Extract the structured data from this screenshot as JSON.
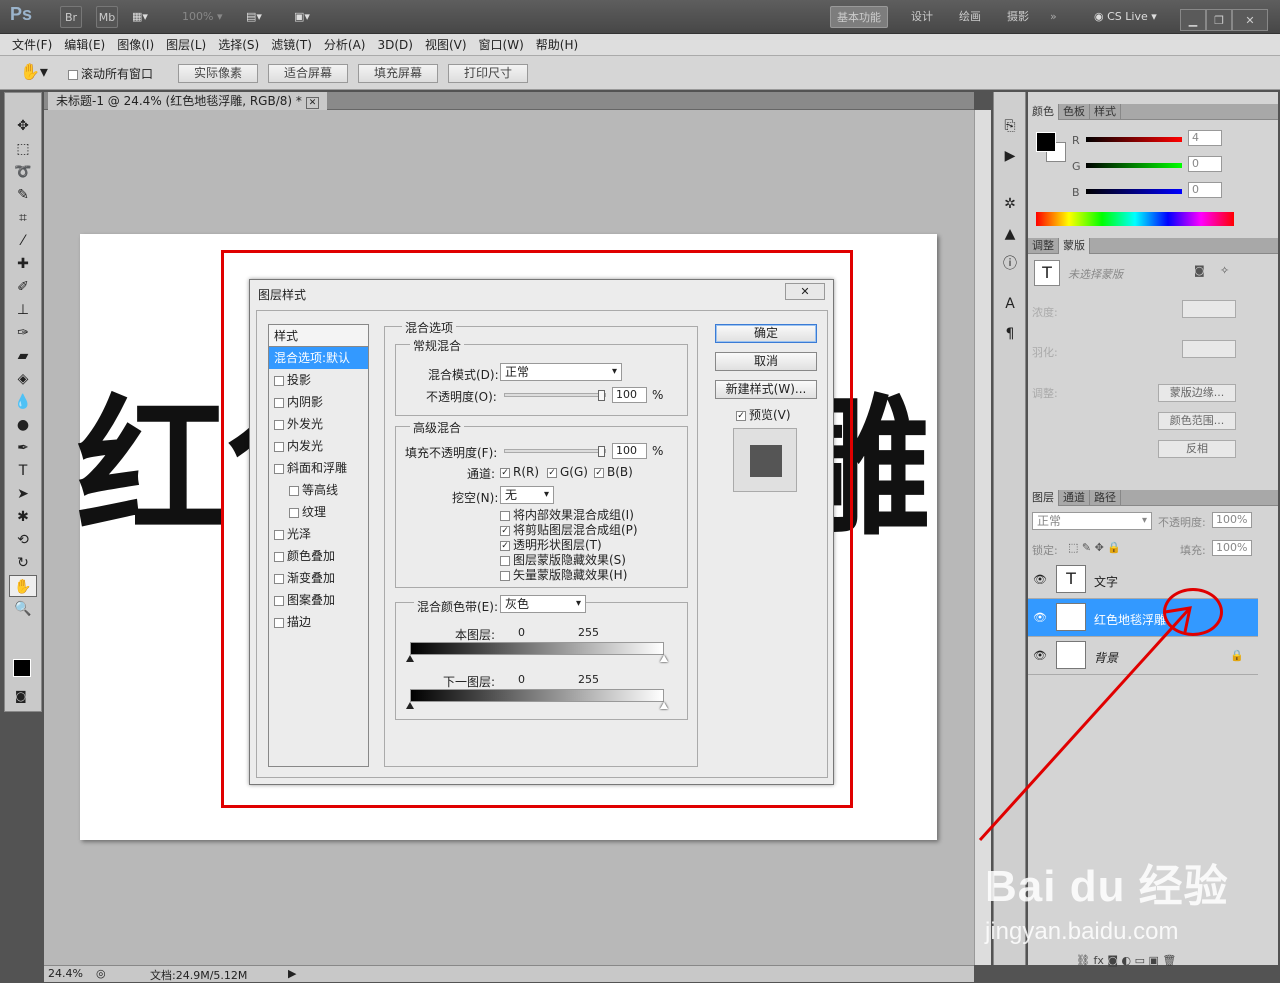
{
  "app": {
    "logo": "Ps",
    "mini_icons": [
      "Br",
      "Mb"
    ],
    "zoom_label": "100%",
    "workspaces": [
      "基本功能",
      "设计",
      "绘画",
      "摄影"
    ],
    "cslive": "CS Live"
  },
  "menu": [
    "文件(F)",
    "编辑(E)",
    "图像(I)",
    "图层(L)",
    "选择(S)",
    "滤镜(T)",
    "分析(A)",
    "3D(D)",
    "视图(V)",
    "窗口(W)",
    "帮助(H)"
  ],
  "options": {
    "scroll_all": "滚动所有窗口",
    "buttons": [
      "实际像素",
      "适合屏幕",
      "填充屏幕",
      "打印尺寸"
    ]
  },
  "document": {
    "tab": "未标题-1 @ 24.4% (红色地毯浮雕, RGB/8) *",
    "text_left": "红色",
    "text_right": "雕"
  },
  "status": {
    "zoom": "24.4%",
    "doc": "文档:24.9M/5.12M"
  },
  "dialog": {
    "title": "图层样式",
    "close": "✕",
    "styles_header": "样式",
    "styles": [
      {
        "label": "混合选项:默认",
        "checkbox": false,
        "selected": true,
        "indent": false
      },
      {
        "label": "投影",
        "checkbox": true,
        "indent": false
      },
      {
        "label": "内阴影",
        "checkbox": true,
        "indent": false
      },
      {
        "label": "外发光",
        "checkbox": true,
        "indent": false
      },
      {
        "label": "内发光",
        "checkbox": true,
        "indent": false
      },
      {
        "label": "斜面和浮雕",
        "checkbox": true,
        "indent": false
      },
      {
        "label": "等高线",
        "checkbox": true,
        "indent": true
      },
      {
        "label": "纹理",
        "checkbox": true,
        "indent": true
      },
      {
        "label": "光泽",
        "checkbox": true,
        "indent": false
      },
      {
        "label": "颜色叠加",
        "checkbox": true,
        "indent": false
      },
      {
        "label": "渐变叠加",
        "checkbox": true,
        "indent": false
      },
      {
        "label": "图案叠加",
        "checkbox": true,
        "indent": false
      },
      {
        "label": "描边",
        "checkbox": true,
        "indent": false
      }
    ],
    "blend_options": "混合选项",
    "general": "常规混合",
    "blend_mode_label": "混合模式(D):",
    "blend_mode": "正常",
    "opacity_label": "不透明度(O):",
    "opacity": "100",
    "pct": "%",
    "advanced": "高级混合",
    "fill_label": "填充不透明度(F):",
    "fill": "100",
    "channels_label": "通道:",
    "channels": [
      "R(R)",
      "G(G)",
      "B(B)"
    ],
    "knockout_label": "挖空(N):",
    "knockout": "无",
    "checks": [
      {
        "label": "将内部效果混合成组(I)",
        "checked": false
      },
      {
        "label": "将剪贴图层混合成组(P)",
        "checked": true
      },
      {
        "label": "透明形状图层(T)",
        "checked": true
      },
      {
        "label": "图层蒙版隐藏效果(S)",
        "checked": false
      },
      {
        "label": "矢量蒙版隐藏效果(H)",
        "checked": false
      }
    ],
    "blendif_label": "混合颜色带(E):",
    "blendif": "灰色",
    "this_layer": "本图层:",
    "under_layer": "下一图层:",
    "v0": "0",
    "v255": "255",
    "ok": "确定",
    "cancel": "取消",
    "new_style": "新建样式(W)...",
    "preview": "预览(V)"
  },
  "color_panel": {
    "tabs": [
      "颜色",
      "色板",
      "样式"
    ],
    "r": "R",
    "g": "G",
    "b": "B",
    "r_val": "4",
    "g_val": "0",
    "b_val": "0"
  },
  "adjust_panel": {
    "tabs": [
      "调整",
      "蒙版"
    ],
    "no_mask": "未选择蒙版",
    "density": "浓度:",
    "feather": "羽化:",
    "refine": "调整:",
    "btn_edge": "蒙版边缘...",
    "btn_range": "颜色范围...",
    "btn_invert": "反相"
  },
  "layers_panel": {
    "tabs": [
      "图层",
      "通道",
      "路径"
    ],
    "mode": "正常",
    "opacity_label": "不透明度:",
    "opacity": "100%",
    "lock_label": "锁定:",
    "fill_label": "填充:",
    "fill": "100%",
    "layers": [
      {
        "name": "文字",
        "type": "T",
        "selected": false
      },
      {
        "name": "红色地毯浮雕",
        "type": "T",
        "selected": true
      },
      {
        "name": "背景",
        "type": "",
        "selected": false,
        "locked": true
      }
    ]
  },
  "watermark": {
    "brand": "Bai du 经验",
    "url": "jingyan.baidu.com"
  },
  "colors": {
    "annotation": "#e00000",
    "selection": "#3399ff"
  }
}
